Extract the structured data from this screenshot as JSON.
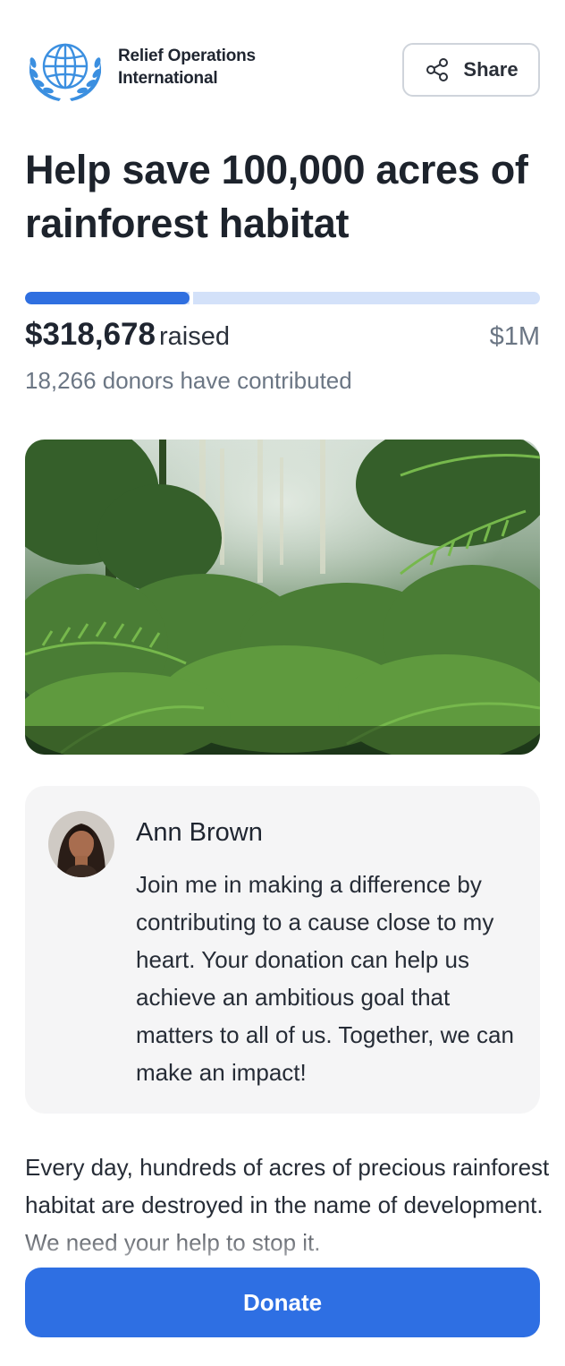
{
  "header": {
    "org_name_line1": "Relief Operations",
    "org_name_line2": "International",
    "logo_icon": "un-globe-emblem-icon",
    "share_label": "Share",
    "share_icon": "share-icon"
  },
  "campaign": {
    "title": "Help save 100,000 acres of rainforest habitat",
    "raised_amount": "$318,678",
    "raised_word": "raised",
    "goal_label": "$1M",
    "progress_fraction": 0.318678,
    "donors_text": "18,266 donors have contributed"
  },
  "hero_image": {
    "alt": "rainforest-photo"
  },
  "testimonial": {
    "name": "Ann Brown",
    "message": "Join me in making a difference by contributing to a cause close to my heart. Your donation can help us achieve an ambitious goal that matters to all of us. Together, we can make an impact!"
  },
  "description": {
    "paragraph": "Every day, hundreds of acres of precious rainforest habitat are destroyed in the name of development. We need your help to stop it."
  },
  "cta": {
    "donate_label": "Donate"
  },
  "colors": {
    "accent": "#2e6fe3",
    "progress_track": "#d3e1f9",
    "muted_text": "#6b7684",
    "card_bg": "#f5f5f6",
    "logo_blue": "#3b8fe0"
  }
}
